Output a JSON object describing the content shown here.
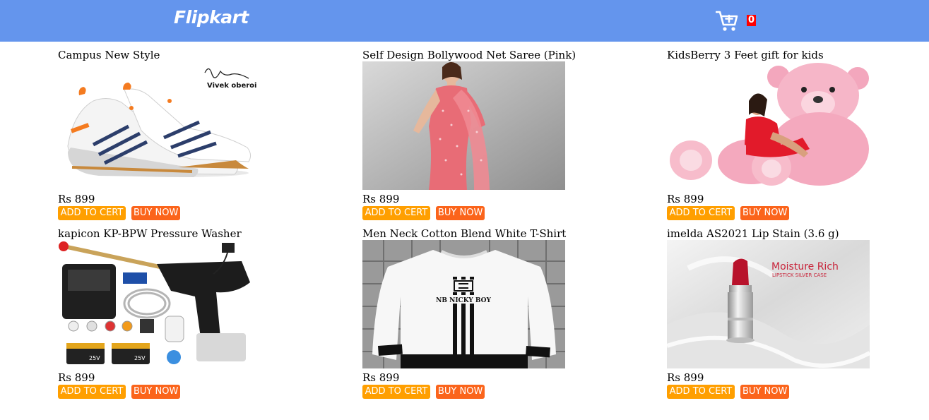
{
  "header": {
    "logo": "Flipkart",
    "cart_icon": "cart-plus-icon",
    "cart_count": "0"
  },
  "products": [
    {
      "title": "Campus New Style",
      "price": "Rs 899",
      "add_to_cart": "ADD TO CERT",
      "buy_now": "BUY NOW",
      "image_caption": "Vivek oberoi"
    },
    {
      "title": "Self Design Bollywood Net Saree (Pink)",
      "price": "Rs 899",
      "add_to_cart": "ADD TO CERT",
      "buy_now": "BUY NOW"
    },
    {
      "title": "KidsBerry 3 Feet gift for kids",
      "price": "Rs 899",
      "add_to_cart": "ADD TO CERT",
      "buy_now": "BUY NOW"
    },
    {
      "title": "kapicon KP-BPW Pressure Washer",
      "price": "Rs 899",
      "add_to_cart": "ADD TO CERT",
      "buy_now": "BUY NOW",
      "image_caption": "25V"
    },
    {
      "title": "Men Neck Cotton Blend White T-Shirt",
      "price": "Rs 899",
      "add_to_cart": "ADD TO CERT",
      "buy_now": "BUY NOW",
      "image_caption": "NB NICKY BOY"
    },
    {
      "title": "imelda AS2021 Lip Stain (3.6 g)",
      "price": "Rs 899",
      "add_to_cart": "ADD TO CERT",
      "buy_now": "BUY NOW",
      "image_caption": "Moisture Rich",
      "image_subcaption": "LIPSTICK SILVER CASE"
    }
  ],
  "colors": {
    "header": "#6495ed",
    "add_to_cart": "#ff9f00",
    "buy_now": "#fb641b",
    "cart_badge": "#ff0000"
  }
}
